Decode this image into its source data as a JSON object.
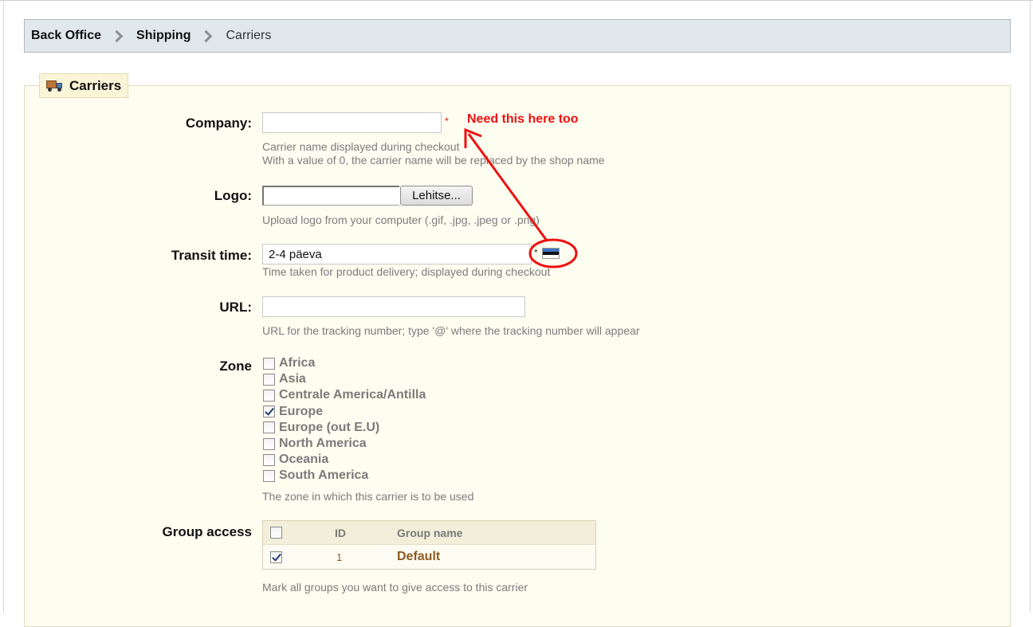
{
  "breadcrumb": {
    "items": [
      "Back Office",
      "Shipping"
    ],
    "current": "Carriers"
  },
  "section": {
    "title": "Carriers",
    "icon": "truck-icon"
  },
  "form": {
    "company": {
      "label": "Company:",
      "value": "",
      "required_mark": "*",
      "hint_line1": "Carrier name displayed during checkout",
      "hint_line2": "With a value of 0, the carrier name will be replaced by the shop name"
    },
    "logo": {
      "label": "Logo:",
      "browse_label": "Lehitse...",
      "hint": "Upload logo from your computer (.gif, .jpg, .jpeg or .png)"
    },
    "transit_time": {
      "label": "Transit time:",
      "value": "2-4 päeva",
      "required_mark": "*",
      "language_flag": "estonian-flag-icon",
      "hint": "Time taken for product delivery; displayed during checkout"
    },
    "url": {
      "label": "URL:",
      "value": "",
      "hint": "URL for the tracking number; type '@' where the tracking number will appear"
    },
    "zone": {
      "label": "Zone",
      "items": [
        {
          "label": "Africa",
          "checked": false
        },
        {
          "label": "Asia",
          "checked": false
        },
        {
          "label": "Centrale America/Antilla",
          "checked": false
        },
        {
          "label": "Europe",
          "checked": true
        },
        {
          "label": "Europe (out E.U)",
          "checked": false
        },
        {
          "label": "North America",
          "checked": false
        },
        {
          "label": "Oceania",
          "checked": false
        },
        {
          "label": "South America",
          "checked": false
        }
      ],
      "hint": "The zone in which this carrier is to be used"
    },
    "group_access": {
      "label": "Group access",
      "columns": [
        "ID",
        "Group name"
      ],
      "rows": [
        {
          "id": "1",
          "name": "Default",
          "checked": true
        }
      ],
      "hint": "Mark all groups you want to give access to this carrier"
    }
  },
  "annotation": {
    "text": "Need this here too",
    "color": "#ee1111"
  }
}
